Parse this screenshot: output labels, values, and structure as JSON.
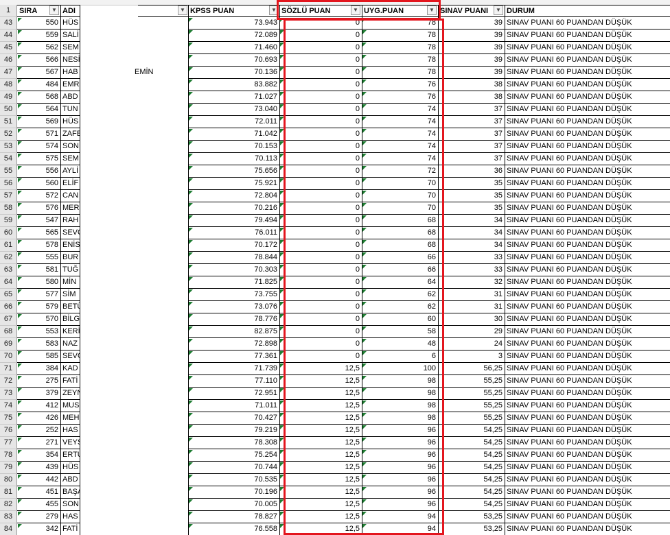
{
  "header_row_number": "1",
  "headers": {
    "sira": "SIRA",
    "adi": "ADI",
    "kpss": "KPSS PUAN",
    "sozlu": "SÖZLÜ PUAN",
    "uyg": "UYG.PUAN",
    "sinav": "SINAV PUANI",
    "durum": "DURUM"
  },
  "filter_icon": "dropdown-arrow-icon",
  "highlight_color": "#e3161e",
  "rows": [
    {
      "n": "43",
      "sira": "550",
      "adi": "HÜS",
      "suffix": "",
      "kpss": "73.943",
      "sozlu": "0",
      "uyg": "78",
      "sinav": "39",
      "durum": "SINAV PUANI 60 PUANDAN DÜŞÜK"
    },
    {
      "n": "44",
      "sira": "559",
      "adi": "SALİ",
      "suffix": "",
      "kpss": "72.089",
      "sozlu": "0",
      "uyg": "78",
      "sinav": "39",
      "durum": "SINAV PUANI 60 PUANDAN DÜŞÜK"
    },
    {
      "n": "45",
      "sira": "562",
      "adi": "SEM",
      "suffix": "",
      "kpss": "71.460",
      "sozlu": "0",
      "uyg": "78",
      "sinav": "39",
      "durum": "SINAV PUANI 60 PUANDAN DÜŞÜK"
    },
    {
      "n": "46",
      "sira": "566",
      "adi": "NESİ",
      "suffix": "",
      "kpss": "70.693",
      "sozlu": "0",
      "uyg": "78",
      "sinav": "39",
      "durum": "SINAV PUANI 60 PUANDAN DÜŞÜK"
    },
    {
      "n": "47",
      "sira": "567",
      "adi": "HAB",
      "suffix": "EMİN",
      "kpss": "70.136",
      "sozlu": "0",
      "uyg": "78",
      "sinav": "39",
      "durum": "SINAV PUANI 60 PUANDAN DÜŞÜK"
    },
    {
      "n": "48",
      "sira": "484",
      "adi": "EMR",
      "suffix": "",
      "kpss": "83.882",
      "sozlu": "0",
      "uyg": "76",
      "sinav": "38",
      "durum": "SINAV PUANI 60 PUANDAN DÜŞÜK"
    },
    {
      "n": "49",
      "sira": "568",
      "adi": "ABD",
      "suffix": "",
      "kpss": "71.027",
      "sozlu": "0",
      "uyg": "76",
      "sinav": "38",
      "durum": "SINAV PUANI 60 PUANDAN DÜŞÜK"
    },
    {
      "n": "50",
      "sira": "564",
      "adi": "TUN",
      "suffix": "",
      "kpss": "73.040",
      "sozlu": "0",
      "uyg": "74",
      "sinav": "37",
      "durum": "SINAV PUANI 60 PUANDAN DÜŞÜK"
    },
    {
      "n": "51",
      "sira": "569",
      "adi": "HÜS",
      "suffix": "",
      "kpss": "72.011",
      "sozlu": "0",
      "uyg": "74",
      "sinav": "37",
      "durum": "SINAV PUANI 60 PUANDAN DÜŞÜK"
    },
    {
      "n": "52",
      "sira": "571",
      "adi": "ZAFE",
      "suffix": "",
      "kpss": "71.042",
      "sozlu": "0",
      "uyg": "74",
      "sinav": "37",
      "durum": "SINAV PUANI 60 PUANDAN DÜŞÜK"
    },
    {
      "n": "53",
      "sira": "574",
      "adi": "SON",
      "suffix": "",
      "kpss": "70.153",
      "sozlu": "0",
      "uyg": "74",
      "sinav": "37",
      "durum": "SINAV PUANI 60 PUANDAN DÜŞÜK"
    },
    {
      "n": "54",
      "sira": "575",
      "adi": "SEM",
      "suffix": "",
      "kpss": "70.113",
      "sozlu": "0",
      "uyg": "74",
      "sinav": "37",
      "durum": "SINAV PUANI 60 PUANDAN DÜŞÜK"
    },
    {
      "n": "55",
      "sira": "556",
      "adi": "AYLİ",
      "suffix": "",
      "kpss": "75.656",
      "sozlu": "0",
      "uyg": "72",
      "sinav": "36",
      "durum": "SINAV PUANI 60 PUANDAN DÜŞÜK"
    },
    {
      "n": "56",
      "sira": "560",
      "adi": "ELİF",
      "suffix": "",
      "kpss": "75.921",
      "sozlu": "0",
      "uyg": "70",
      "sinav": "35",
      "durum": "SINAV PUANI 60 PUANDAN DÜŞÜK"
    },
    {
      "n": "57",
      "sira": "572",
      "adi": "CAN",
      "suffix": "",
      "kpss": "72.804",
      "sozlu": "0",
      "uyg": "70",
      "sinav": "35",
      "durum": "SINAV PUANI 60 PUANDAN DÜŞÜK"
    },
    {
      "n": "58",
      "sira": "576",
      "adi": "MER",
      "suffix": "",
      "kpss": "70.216",
      "sozlu": "0",
      "uyg": "70",
      "sinav": "35",
      "durum": "SINAV PUANI 60 PUANDAN DÜŞÜK"
    },
    {
      "n": "59",
      "sira": "547",
      "adi": "RAH",
      "suffix": "",
      "kpss": "79.494",
      "sozlu": "0",
      "uyg": "68",
      "sinav": "34",
      "durum": "SINAV PUANI 60 PUANDAN DÜŞÜK"
    },
    {
      "n": "60",
      "sira": "565",
      "adi": "SEVO",
      "suffix": "",
      "kpss": "76.011",
      "sozlu": "0",
      "uyg": "68",
      "sinav": "34",
      "durum": "SINAV PUANI 60 PUANDAN DÜŞÜK"
    },
    {
      "n": "61",
      "sira": "578",
      "adi": "ENİS",
      "suffix": "",
      "kpss": "70.172",
      "sozlu": "0",
      "uyg": "68",
      "sinav": "34",
      "durum": "SINAV PUANI 60 PUANDAN DÜŞÜK"
    },
    {
      "n": "62",
      "sira": "555",
      "adi": "BUR",
      "suffix": "",
      "kpss": "78.844",
      "sozlu": "0",
      "uyg": "66",
      "sinav": "33",
      "durum": "SINAV PUANI 60 PUANDAN DÜŞÜK"
    },
    {
      "n": "63",
      "sira": "581",
      "adi": "TUĞ",
      "suffix": "",
      "kpss": "70.303",
      "sozlu": "0",
      "uyg": "66",
      "sinav": "33",
      "durum": "SINAV PUANI 60 PUANDAN DÜŞÜK"
    },
    {
      "n": "64",
      "sira": "580",
      "adi": "MİN",
      "suffix": "",
      "kpss": "71.825",
      "sozlu": "0",
      "uyg": "64",
      "sinav": "32",
      "durum": "SINAV PUANI 60 PUANDAN DÜŞÜK"
    },
    {
      "n": "65",
      "sira": "577",
      "adi": "SİM",
      "suffix": "",
      "kpss": "73.755",
      "sozlu": "0",
      "uyg": "62",
      "sinav": "31",
      "durum": "SINAV PUANI 60 PUANDAN DÜŞÜK"
    },
    {
      "n": "66",
      "sira": "579",
      "adi": "BETÜ",
      "suffix": "",
      "kpss": "73.076",
      "sozlu": "0",
      "uyg": "62",
      "sinav": "31",
      "durum": "SINAV PUANI 60 PUANDAN DÜŞÜK"
    },
    {
      "n": "67",
      "sira": "570",
      "adi": "BİLG",
      "suffix": "",
      "kpss": "78.776",
      "sozlu": "0",
      "uyg": "60",
      "sinav": "30",
      "durum": "SINAV PUANI 60 PUANDAN DÜŞÜK"
    },
    {
      "n": "68",
      "sira": "553",
      "adi": "KERİ",
      "suffix": "",
      "kpss": "82.875",
      "sozlu": "0",
      "uyg": "58",
      "sinav": "29",
      "durum": "SINAV PUANI 60 PUANDAN DÜŞÜK"
    },
    {
      "n": "69",
      "sira": "583",
      "adi": "NAZ",
      "suffix": "",
      "kpss": "72.898",
      "sozlu": "0",
      "uyg": "48",
      "sinav": "24",
      "durum": "SINAV PUANI 60 PUANDAN DÜŞÜK"
    },
    {
      "n": "70",
      "sira": "585",
      "adi": "SEVO",
      "suffix": "",
      "kpss": "77.361",
      "sozlu": "0",
      "uyg": "6",
      "sinav": "3",
      "durum": "SINAV PUANI 60 PUANDAN DÜŞÜK"
    },
    {
      "n": "71",
      "sira": "384",
      "adi": "KAD",
      "suffix": "",
      "kpss": "71.739",
      "sozlu": "12,5",
      "uyg": "100",
      "sinav": "56,25",
      "durum": "SINAV PUANI 60 PUANDAN DÜŞÜK"
    },
    {
      "n": "72",
      "sira": "275",
      "adi": "FATİ",
      "suffix": "",
      "kpss": "77.110",
      "sozlu": "12,5",
      "uyg": "98",
      "sinav": "55,25",
      "durum": "SINAV PUANI 60 PUANDAN DÜŞÜK"
    },
    {
      "n": "73",
      "sira": "379",
      "adi": "ZEYN",
      "suffix": "",
      "kpss": "72.951",
      "sozlu": "12,5",
      "uyg": "98",
      "sinav": "55,25",
      "durum": "SINAV PUANI 60 PUANDAN DÜŞÜK"
    },
    {
      "n": "74",
      "sira": "412",
      "adi": "MUS",
      "suffix": "",
      "kpss": "71.011",
      "sozlu": "12,5",
      "uyg": "98",
      "sinav": "55,25",
      "durum": "SINAV PUANI 60 PUANDAN DÜŞÜK"
    },
    {
      "n": "75",
      "sira": "426",
      "adi": "MEH",
      "suffix": "",
      "kpss": "70.427",
      "sozlu": "12,5",
      "uyg": "98",
      "sinav": "55,25",
      "durum": "SINAV PUANI 60 PUANDAN DÜŞÜK"
    },
    {
      "n": "76",
      "sira": "252",
      "adi": "HAS",
      "suffix": "",
      "kpss": "79.219",
      "sozlu": "12,5",
      "uyg": "96",
      "sinav": "54,25",
      "durum": "SINAV PUANI 60 PUANDAN DÜŞÜK"
    },
    {
      "n": "77",
      "sira": "271",
      "adi": "VEYS",
      "suffix": "",
      "kpss": "78.308",
      "sozlu": "12,5",
      "uyg": "96",
      "sinav": "54,25",
      "durum": "SINAV PUANI 60 PUANDAN DÜŞÜK"
    },
    {
      "n": "78",
      "sira": "354",
      "adi": "ERTU",
      "suffix": "",
      "kpss": "75.254",
      "sozlu": "12,5",
      "uyg": "96",
      "sinav": "54,25",
      "durum": "SINAV PUANI 60 PUANDAN DÜŞÜK"
    },
    {
      "n": "79",
      "sira": "439",
      "adi": "HÜS",
      "suffix": "",
      "kpss": "70.744",
      "sozlu": "12,5",
      "uyg": "96",
      "sinav": "54,25",
      "durum": "SINAV PUANI 60 PUANDAN DÜŞÜK"
    },
    {
      "n": "80",
      "sira": "442",
      "adi": "ABD",
      "suffix": "",
      "kpss": "70.535",
      "sozlu": "12,5",
      "uyg": "96",
      "sinav": "54,25",
      "durum": "SINAV PUANI 60 PUANDAN DÜŞÜK"
    },
    {
      "n": "81",
      "sira": "451",
      "adi": "BAŞA",
      "suffix": "",
      "kpss": "70.196",
      "sozlu": "12,5",
      "uyg": "96",
      "sinav": "54,25",
      "durum": "SINAV PUANI 60 PUANDAN DÜŞÜK"
    },
    {
      "n": "82",
      "sira": "455",
      "adi": "SON",
      "suffix": "",
      "kpss": "70.005",
      "sozlu": "12,5",
      "uyg": "96",
      "sinav": "54,25",
      "durum": "SINAV PUANI 60 PUANDAN DÜŞÜK"
    },
    {
      "n": "83",
      "sira": "279",
      "adi": "HAS",
      "suffix": "",
      "kpss": "78.827",
      "sozlu": "12,5",
      "uyg": "94",
      "sinav": "53,25",
      "durum": "SINAV PUANI 60 PUANDAN DÜŞÜK"
    },
    {
      "n": "84",
      "sira": "342",
      "adi": "FATİ",
      "suffix": "",
      "kpss": "76.558",
      "sozlu": "12,5",
      "uyg": "94",
      "sinav": "53,25",
      "durum": "SINAV PUANI 60 PUANDAN DÜŞÜK"
    }
  ]
}
